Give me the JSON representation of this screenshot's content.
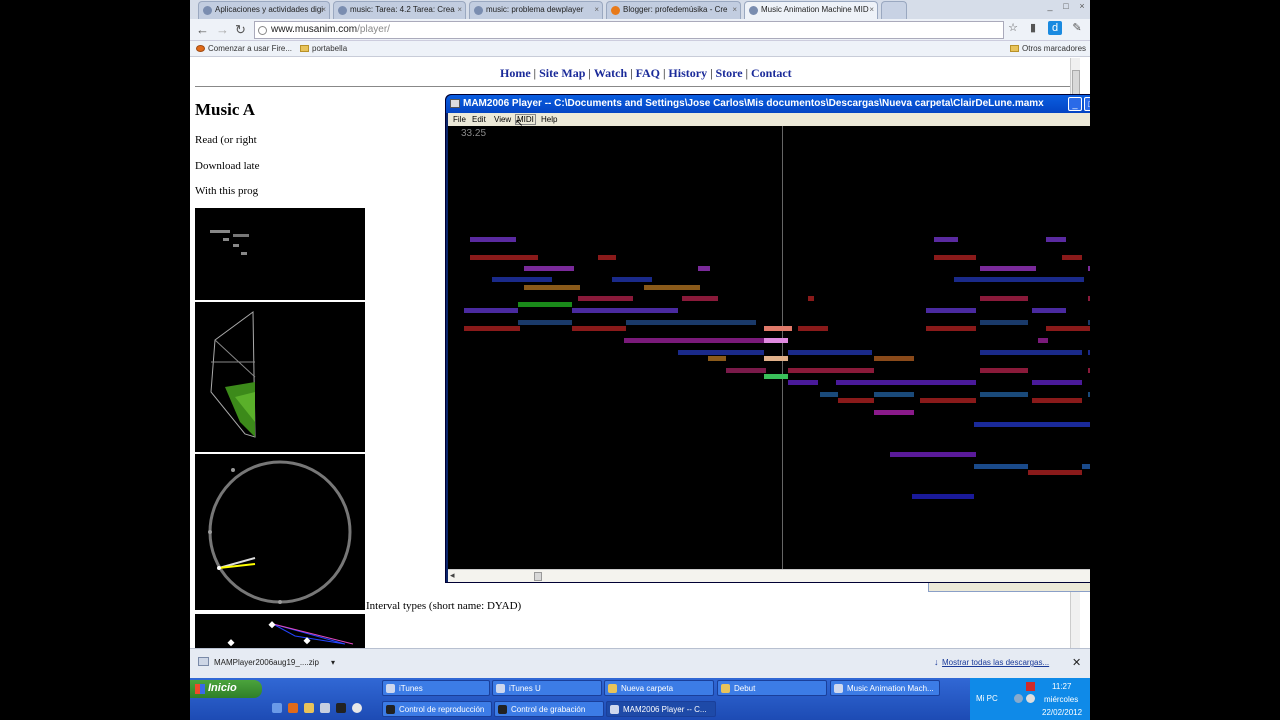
{
  "browser": {
    "tabs": [
      {
        "label": "Aplicaciones y actividades digi"
      },
      {
        "label": "music: Tarea: 4.2 Tarea: Crea"
      },
      {
        "label": "music: problema dewplayer"
      },
      {
        "label": "Blogger: profedemúsika - Cre"
      },
      {
        "label": "Music Animation Machine MID"
      }
    ],
    "url_host": "www.musanim.com",
    "url_path": "/player/",
    "bookmarks": [
      "Comenzar a usar Fire...",
      "portabella"
    ],
    "other_bookmarks": "Otros marcadores"
  },
  "page": {
    "nav": [
      "Home",
      "Site Map",
      "Watch",
      "FAQ",
      "History",
      "Store",
      "Contact"
    ],
    "heading": "Music A",
    "para1": "Read (or right",
    "para2": "Download late",
    "para3": "With this prog",
    "interval_caption": "Interval types (short name: DYAD)"
  },
  "mam": {
    "title": "MAM2006 Player -- C:\\Documents and Settings\\Jose Carlos\\Mis documentos\\Descargas\\Nueva carpeta\\ClairDeLune.mamx",
    "menu": [
      "File",
      "Edit",
      "View",
      "MIDI",
      "Help"
    ],
    "timecode": "33.25"
  },
  "download": {
    "file": "MAMPlayer2006aug19_....zip",
    "show_all": "Mostrar todas las descargas..."
  },
  "taskbar": {
    "start": "Inicio",
    "row1": [
      "iTunes",
      "iTunes U",
      "Nueva carpeta",
      "Debut",
      "Music Animation Mach..."
    ],
    "row2": [
      "Control de reproducción",
      "Control de grabación",
      "MAM2006 Player -- C..."
    ],
    "tray_label": "Mi PC",
    "time": "11:27",
    "day": "miércoles",
    "date": "22/02/2012"
  }
}
